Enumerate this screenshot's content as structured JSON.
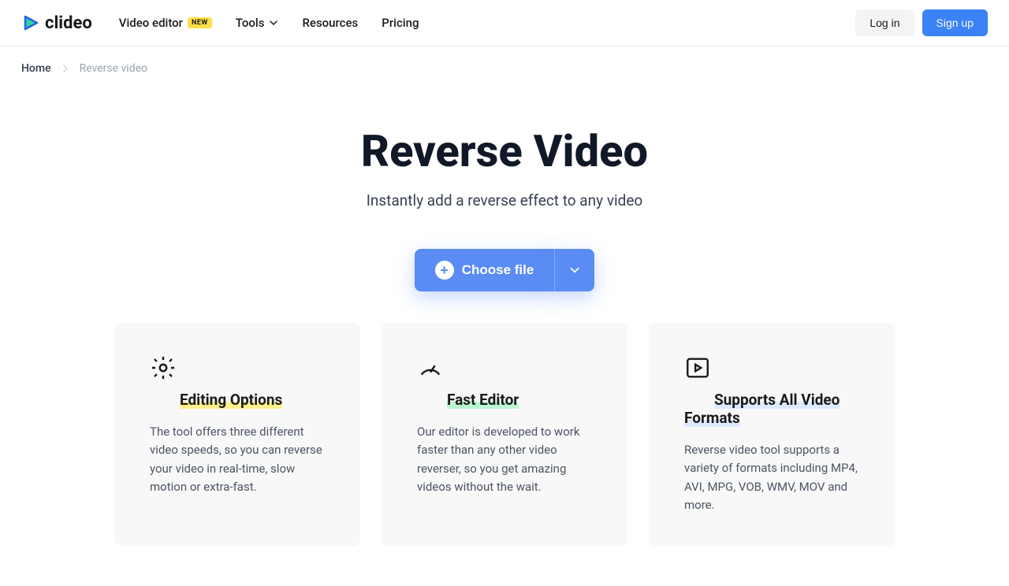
{
  "header": {
    "brand": "clideo",
    "nav": {
      "video_editor": "Video editor",
      "badge": "NEW",
      "tools": "Tools",
      "resources": "Resources",
      "pricing": "Pricing"
    },
    "login": "Log in",
    "signup": "Sign up"
  },
  "breadcrumb": {
    "home": "Home",
    "current": "Reverse video"
  },
  "hero": {
    "title": "Reverse Video",
    "subtitle": "Instantly add a reverse effect to any video",
    "choose": "Choose file"
  },
  "features": [
    {
      "title": "Editing Options",
      "desc": "The tool offers three different video speeds, so you can reverse your video in real-time, slow motion or extra-fast."
    },
    {
      "title": "Fast Editor",
      "desc": "Our editor is developed to work faster than any other video reverser, so you get amazing videos without the wait."
    },
    {
      "title": "Supports All Video Formats",
      "desc": "Reverse video tool supports a variety of formats including MP4, AVI, MPG, VOB, WMV, MOV and more."
    }
  ]
}
